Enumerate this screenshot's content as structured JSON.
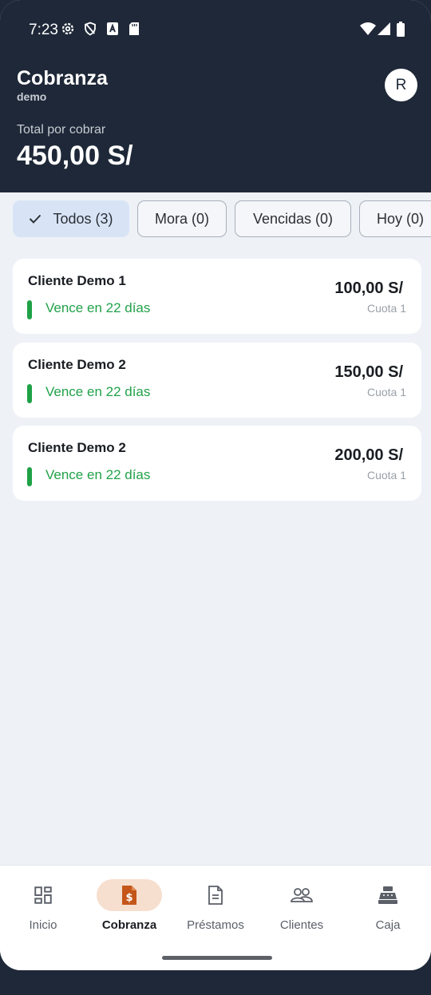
{
  "status_bar": {
    "time": "7:23"
  },
  "header": {
    "title": "Cobranza",
    "subtitle": "demo",
    "avatar_initial": "R",
    "total_label": "Total por cobrar",
    "total_value": "450,00 S/"
  },
  "filters": [
    {
      "label": "Todos (3)",
      "selected": true
    },
    {
      "label": "Mora (0)",
      "selected": false
    },
    {
      "label": "Vencidas (0)",
      "selected": false
    },
    {
      "label": "Hoy (0)",
      "selected": false
    }
  ],
  "payments": [
    {
      "client": "Cliente Demo 1",
      "due": "Vence en 22 días",
      "amount": "100,00 S/",
      "quota": "Cuota 1"
    },
    {
      "client": "Cliente Demo 2",
      "due": "Vence en 22 días",
      "amount": "150,00 S/",
      "quota": "Cuota 1"
    },
    {
      "client": "Cliente Demo 2",
      "due": "Vence en 22 días",
      "amount": "200,00 S/",
      "quota": "Cuota 1"
    }
  ],
  "colors": {
    "header_bg": "#1e2838",
    "due_green": "#22a24a",
    "accent_orange": "#c4561a",
    "active_chip": "#d8e4f6"
  },
  "nav": [
    {
      "label": "Inicio",
      "icon": "dashboard-icon",
      "active": false
    },
    {
      "label": "Cobranza",
      "icon": "invoice-dollar-icon",
      "active": true
    },
    {
      "label": "Préstamos",
      "icon": "document-icon",
      "active": false
    },
    {
      "label": "Clientes",
      "icon": "people-icon",
      "active": false
    },
    {
      "label": "Caja",
      "icon": "cash-register-icon",
      "active": false
    }
  ]
}
